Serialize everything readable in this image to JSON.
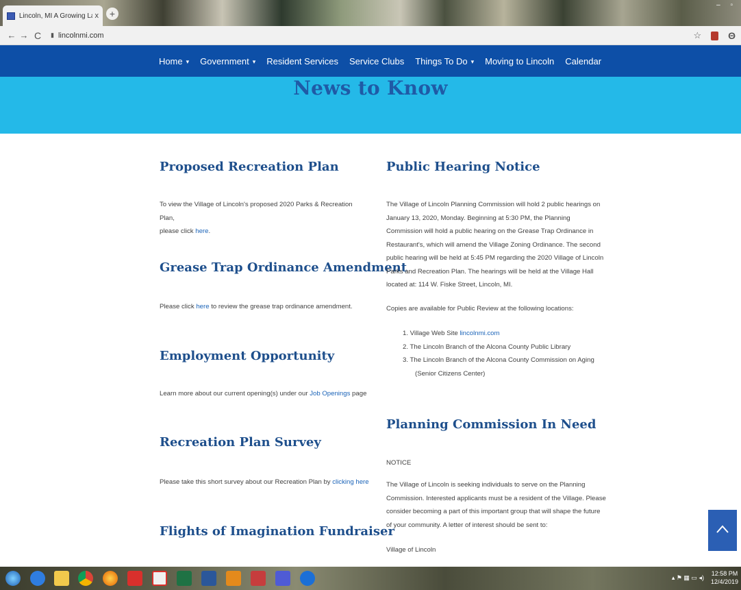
{
  "browser": {
    "tab_title": "Lincoln, MI A Growing Lake Side",
    "tab_close": "x",
    "new_tab": "+",
    "url": "lincolnmi.com",
    "back_icon": "←",
    "forward_icon": "→",
    "reload_icon": "C",
    "star_icon": "☆"
  },
  "nav": {
    "items": [
      {
        "label": "Home",
        "has_dropdown": true
      },
      {
        "label": "Government",
        "has_dropdown": true
      },
      {
        "label": "Resident Services",
        "has_dropdown": false
      },
      {
        "label": "Service Clubs",
        "has_dropdown": false
      },
      {
        "label": "Things To Do",
        "has_dropdown": true
      },
      {
        "label": "Moving to Lincoln",
        "has_dropdown": false
      },
      {
        "label": "Calendar",
        "has_dropdown": false
      }
    ],
    "caret": "▾"
  },
  "hero": {
    "title": "News to Know"
  },
  "left": {
    "recreation": {
      "heading": "Proposed Recreation Plan",
      "text_line1": "To view the Village of Lincoln's proposed 2020 Parks & Recreation Plan,",
      "text_line2": "please click ",
      "link": "here",
      "after": "."
    },
    "grease": {
      "heading": "Grease Trap Ordinance Amendment",
      "before": "Please click ",
      "link": "here",
      "after": " to review the grease trap ordinance amendment."
    },
    "employment": {
      "heading": "Employment Opportunity",
      "before": "Learn more about our current opening(s) under our ",
      "link": "Job Openings",
      "after": " page"
    },
    "survey": {
      "heading": "Recreation Plan Survey",
      "before": "Please take this short survey about our Recreation Plan by ",
      "link": "clicking here"
    },
    "flights": {
      "heading": "Flights of Imagination Fundraiser"
    }
  },
  "right": {
    "hearing": {
      "heading": "Public Hearing Notice",
      "lines": [
        "The Village of Lincoln Planning Commission will hold 2 public hearings on",
        "January 13, 2020, Monday.  Beginning at 5:30 PM, the Planning",
        "Commission will hold a public hearing on the Grease Trap Ordinance in",
        "Restaurant's, which will amend the Village Zoning Ordinance.  The second",
        "public hearing will be held at 5:45 PM regarding the 2020 Village of Lincoln",
        "Parks and Recreation Plan.   The hearings will be held at the Village Hall",
        "located at: 114 W. Fiske Street, Lincoln, MI."
      ],
      "copies_intro": "Copies are available for Public Review at the following locations:",
      "copies": {
        "item1_text": "1. Village Web Site ",
        "item1_link": "lincolnmi.com",
        "item2": "2. The Lincoln Branch of the Alcona County Public Library",
        "item3": "3. The Lincoln Branch of the Alcona County Commission on Aging",
        "item3_cont": "(Senior Citizens Center)"
      }
    },
    "planning": {
      "heading": "Planning Commission In Need",
      "notice": "NOTICE",
      "lines": [
        "The Village of Lincoln is seeking individuals to serve on the Planning",
        "Commission. Interested applicants must be a resident of the Village. Please",
        "consider becoming a part of this important group that will shape the future",
        "of your community. A letter of interest should be sent to:"
      ],
      "address": "Village of Lincoln"
    }
  },
  "taskbar": {
    "clock_time": "12:58 PM",
    "clock_date": "12/4/2019"
  },
  "colors": {
    "nav_bg": "#0d4fa7",
    "hero_bg": "#24b9e8",
    "heading": "#1e4f8c",
    "link": "#1a63b8",
    "scroll_top_bg": "#2b5fb4"
  }
}
